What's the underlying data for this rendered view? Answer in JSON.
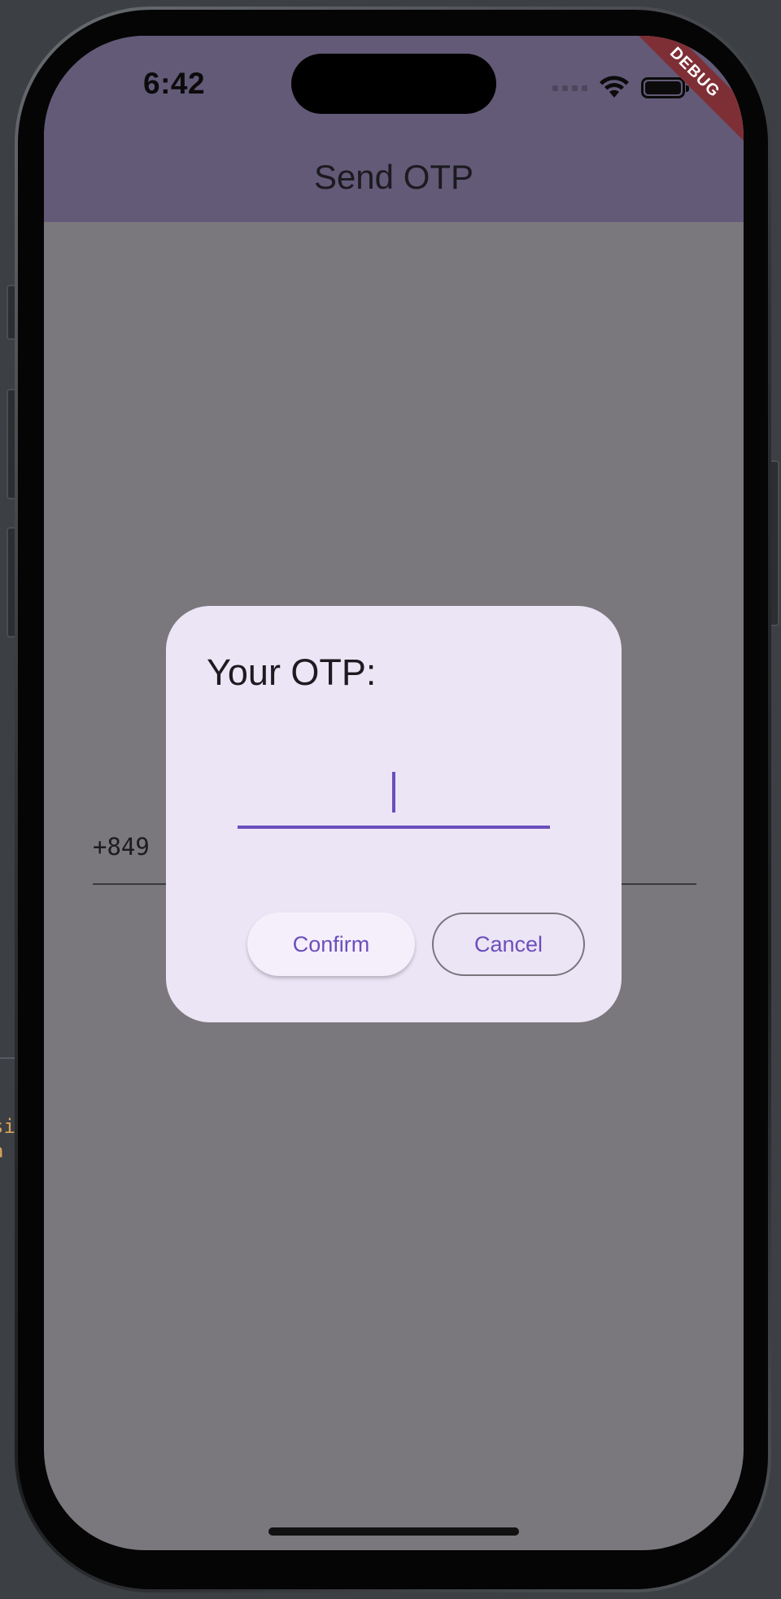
{
  "status_bar": {
    "time": "6:42",
    "icons": [
      "signal-icon",
      "wifi-icon",
      "battery-icon"
    ]
  },
  "app_bar": {
    "title": "Send OTP",
    "color": "#635a78"
  },
  "debug_banner": {
    "label": "DEBUG",
    "color": "#7e2f35"
  },
  "phone_field": {
    "value": "+849"
  },
  "dialog": {
    "title": "Your OTP:",
    "otp_value": "",
    "confirm_label": "Confirm",
    "cancel_label": "Cancel",
    "background": "#ece5f6",
    "accent": "#6b4fbb"
  },
  "background": {
    "code_fragments": [
      "si",
      "a"
    ]
  }
}
